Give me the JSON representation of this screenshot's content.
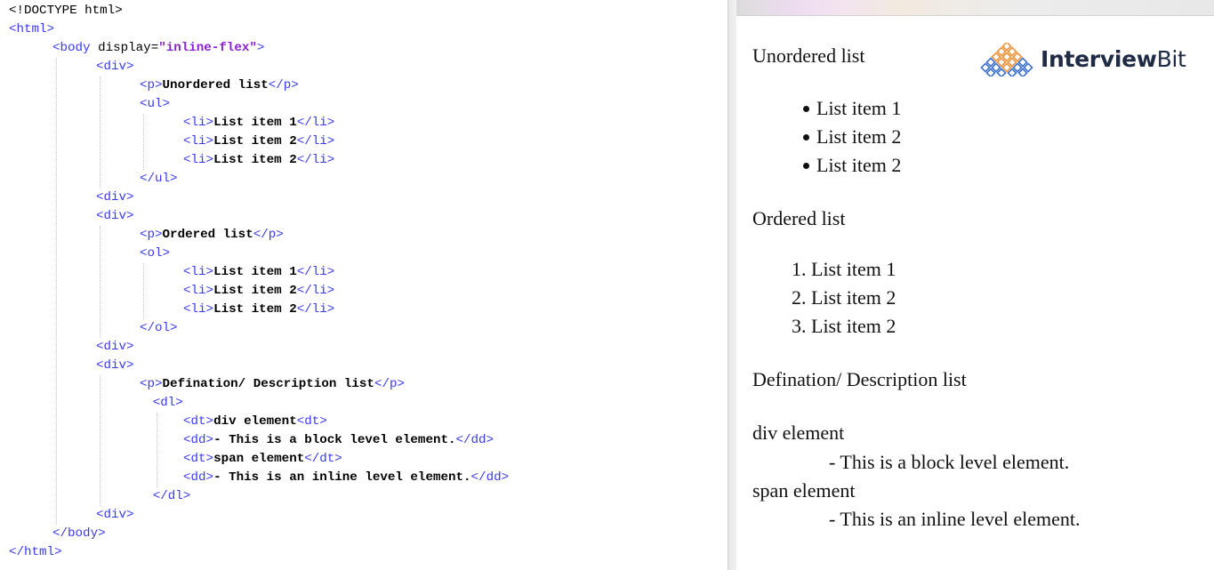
{
  "editor": {
    "lines": [
      {
        "indent": 0,
        "parts": [
          [
            "sel",
            "<!"
          ],
          [
            "plain",
            "DOCTYPE html"
          ],
          [
            "sel",
            ">"
          ]
        ]
      },
      {
        "indent": 0,
        "parts": [
          [
            "tag",
            "<html>"
          ]
        ]
      },
      {
        "indent": 1,
        "parts": [
          [
            "tag",
            "<body "
          ],
          [
            "attr",
            "display="
          ],
          [
            "val",
            "\"inline-flex\""
          ],
          [
            "tag",
            ">"
          ]
        ]
      },
      {
        "indent": 2,
        "parts": [
          [
            "tag",
            "<div>"
          ]
        ]
      },
      {
        "indent": 3,
        "parts": [
          [
            "tag",
            "<p>"
          ],
          [
            "text",
            "Unordered list"
          ],
          [
            "tag",
            "</p>"
          ]
        ]
      },
      {
        "indent": 3,
        "parts": [
          [
            "tag",
            "<ul>"
          ]
        ]
      },
      {
        "indent": 4,
        "parts": [
          [
            "tag",
            "<li>"
          ],
          [
            "text",
            "List item 1"
          ],
          [
            "tag",
            "</li>"
          ]
        ]
      },
      {
        "indent": 4,
        "parts": [
          [
            "tag",
            "<li>"
          ],
          [
            "text",
            "List item 2"
          ],
          [
            "tag",
            "</li>"
          ]
        ]
      },
      {
        "indent": 4,
        "parts": [
          [
            "tag",
            "<li>"
          ],
          [
            "text",
            "List item 2"
          ],
          [
            "tag",
            "</li>"
          ]
        ]
      },
      {
        "indent": 3,
        "parts": [
          [
            "tag",
            "</ul>"
          ]
        ]
      },
      {
        "indent": 2,
        "parts": [
          [
            "tag",
            "<div>"
          ]
        ]
      },
      {
        "indent": 2,
        "parts": [
          [
            "tag",
            "<div>"
          ]
        ]
      },
      {
        "indent": 3,
        "parts": [
          [
            "tag",
            "<p>"
          ],
          [
            "text",
            "Ordered list"
          ],
          [
            "tag",
            "</p>"
          ]
        ]
      },
      {
        "indent": 3,
        "parts": [
          [
            "tag",
            "<ol>"
          ]
        ]
      },
      {
        "indent": 4,
        "parts": [
          [
            "tag",
            "<li>"
          ],
          [
            "text",
            "List item 1"
          ],
          [
            "tag",
            "</li>"
          ]
        ]
      },
      {
        "indent": 4,
        "parts": [
          [
            "tag",
            "<li>"
          ],
          [
            "text",
            "List item 2"
          ],
          [
            "tag",
            "</li>"
          ]
        ]
      },
      {
        "indent": 4,
        "parts": [
          [
            "tag",
            "<li>"
          ],
          [
            "text",
            "List item 2"
          ],
          [
            "tag",
            "</li>"
          ]
        ]
      },
      {
        "indent": 3,
        "parts": [
          [
            "tag",
            "</ol>"
          ]
        ]
      },
      {
        "indent": 2,
        "parts": [
          [
            "tag",
            "<div>"
          ]
        ]
      },
      {
        "indent": 2,
        "parts": [
          [
            "tag",
            "<div>"
          ]
        ]
      },
      {
        "indent": 3,
        "parts": [
          [
            "tag",
            "<p>"
          ],
          [
            "text",
            "Defination/ Description list"
          ],
          [
            "tag",
            "</p>"
          ]
        ]
      },
      {
        "indent": 3.3,
        "parts": [
          [
            "tag",
            "<dl>"
          ]
        ]
      },
      {
        "indent": 4,
        "parts": [
          [
            "tag",
            "<dt>"
          ],
          [
            "text",
            "div element"
          ],
          [
            "tag",
            "<dt>"
          ]
        ]
      },
      {
        "indent": 4,
        "parts": [
          [
            "tag",
            "<dd>"
          ],
          [
            "text",
            "- This is a block level element."
          ],
          [
            "tag",
            "</dd>"
          ]
        ]
      },
      {
        "indent": 4,
        "parts": [
          [
            "tag",
            "<dt>"
          ],
          [
            "text",
            "span element"
          ],
          [
            "tag",
            "</dt>"
          ]
        ]
      },
      {
        "indent": 4,
        "parts": [
          [
            "tag",
            "<dd>"
          ],
          [
            "text",
            "- This is an inline level element."
          ],
          [
            "tag",
            "</dd>"
          ]
        ]
      },
      {
        "indent": 3.3,
        "parts": [
          [
            "tag",
            "</dl>"
          ]
        ]
      },
      {
        "indent": 2,
        "parts": [
          [
            "tag",
            "<div>"
          ]
        ]
      },
      {
        "indent": 1,
        "parts": [
          [
            "tag",
            "</body>"
          ]
        ]
      },
      {
        "indent": 0,
        "parts": [
          [
            "tag",
            "</html>"
          ]
        ]
      }
    ]
  },
  "output": {
    "brand": {
      "name_bold": "Interview",
      "name_regular": "Bit",
      "logo_icon": "interviewbit-diamond-logo"
    },
    "unordered": {
      "heading": "Unordered list",
      "items": [
        "List item 1",
        "List item 2",
        "List item 2"
      ]
    },
    "ordered": {
      "heading": "Ordered list",
      "items": [
        "1. List item 1",
        "2. List item 2",
        "3. List item 2"
      ]
    },
    "description": {
      "heading": "Defination/ Description list",
      "terms": [
        "div element",
        "span element"
      ],
      "definitions": [
        "- This is a block level element.",
        "- This is an inline level element."
      ]
    }
  },
  "colors": {
    "tag": "#3a3af0",
    "attribute_value": "#8a1fd6",
    "selection": "#cfe0f6",
    "brand_text": "#1f2a44",
    "logo_orange": "#f0923a",
    "logo_blue": "#3b6fd1"
  }
}
